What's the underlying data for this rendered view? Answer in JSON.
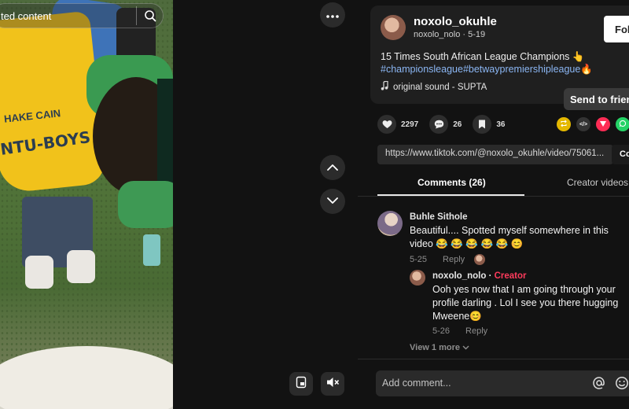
{
  "search": {
    "placeholder": "ted content"
  },
  "video": {
    "shirt_text": "NTU-BOYS",
    "shirt_text2": "HAKE CAIN"
  },
  "post": {
    "username": "noxolo_okuhle",
    "handle_date": "noxolo_nolo · 5-19",
    "follow_label": "Foll",
    "description_text": "15 Times South African League Champions 👆",
    "description_tags": "#championsleague#betwaypremiershipleague🔥",
    "sound": "original sound - SUPTA"
  },
  "tooltip": "Send to friends",
  "stats": {
    "likes": "2297",
    "comments": "26",
    "saves": "36"
  },
  "share": {
    "embed_glyph": "</>"
  },
  "link": {
    "url": "https://www.tiktok.com/@noxolo_okuhle/video/75061...",
    "copy_label": "Co"
  },
  "tabs": {
    "comments": "Comments (26)",
    "creator_videos": "Creator videos"
  },
  "comments": [
    {
      "name": "Buhle Sithole",
      "text": "Beautiful.... Spotted myself somewhere in this video 😂 😂 😂 😂 😂 😊",
      "date": "5-25",
      "reply_label": "Reply"
    }
  ],
  "reply": {
    "name": "noxolo_nolo",
    "creator_tag": "Creator",
    "text": "Ooh yes now that I am going through your profile darling . Lol I see you there hugging Mweene😊",
    "date": "5-26",
    "reply_label": "Reply"
  },
  "view_more": "View 1 more",
  "add_comment": {
    "placeholder": "Add comment..."
  },
  "colors": {
    "accent_red": "#ff3b5c",
    "link_blue": "#8bb6f3",
    "panel_bg": "#121212"
  }
}
